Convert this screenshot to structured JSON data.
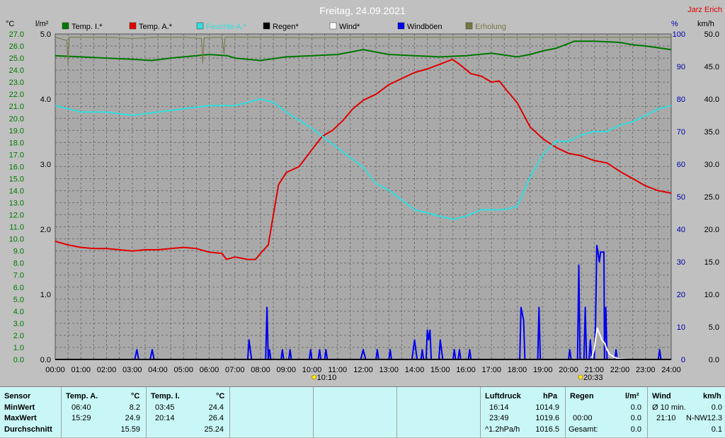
{
  "title": "Freitag, 24.09.2021",
  "station": "Jarz Erich",
  "units": {
    "left_outer": "°C",
    "left_inner": "l/m²",
    "right_inner": "%",
    "right_outer": "km/h"
  },
  "legend": [
    {
      "label": "Temp. I.*",
      "color": "#007700"
    },
    {
      "label": "Temp. A.*",
      "color": "#e00000"
    },
    {
      "label": "Feuchte A.*",
      "color": "#33dddd"
    },
    {
      "label": "Regen*",
      "color": "#000000"
    },
    {
      "label": "Wind*",
      "color": "#ffffff"
    },
    {
      "label": "Windböen",
      "color": "#0000ee"
    },
    {
      "label": "Erholung",
      "color": "#777744"
    }
  ],
  "markers": [
    {
      "time": "10:10",
      "hour": 10.17
    },
    {
      "time": "20:33",
      "hour": 20.55
    }
  ],
  "chart_data": {
    "type": "line",
    "title": "Freitag, 24.09.2021",
    "x_ticks": [
      "00:00",
      "01:00",
      "02:00",
      "03:00",
      "04:00",
      "05:00",
      "06:00",
      "07:00",
      "08:00",
      "09:00",
      "10:00",
      "11:00",
      "12:00",
      "13:00",
      "14:00",
      "15:00",
      "16:00",
      "17:00",
      "18:00",
      "19:00",
      "20:00",
      "21:00",
      "22:00",
      "23:00",
      "24:00"
    ],
    "xlim": [
      0,
      24
    ],
    "axes": {
      "temp_c": {
        "min": 0.0,
        "max": 27.0,
        "step": 1.0,
        "color": "#007700"
      },
      "rain_lm2": {
        "min": 0.0,
        "max": 5.0,
        "step": 1.0,
        "color": "#000000"
      },
      "humidity_pct": {
        "min": 0,
        "max": 100,
        "step": 10,
        "color": "#0000aa"
      },
      "wind_kmh": {
        "min": 0.0,
        "max": 50.0,
        "step": 5.0,
        "color": "#000000"
      }
    },
    "grid": true,
    "series": [
      {
        "name": "Temp. A.*",
        "axis": "temp_c",
        "color": "#e00000",
        "points": [
          [
            0,
            9.8
          ],
          [
            0.5,
            9.5
          ],
          [
            1,
            9.3
          ],
          [
            1.5,
            9.2
          ],
          [
            2,
            9.2
          ],
          [
            2.5,
            9.1
          ],
          [
            3,
            9.0
          ],
          [
            3.5,
            9.1
          ],
          [
            4,
            9.1
          ],
          [
            4.5,
            9.2
          ],
          [
            5,
            9.3
          ],
          [
            5.5,
            9.2
          ],
          [
            6,
            8.9
          ],
          [
            6.5,
            8.8
          ],
          [
            6.67,
            8.3
          ],
          [
            7,
            8.5
          ],
          [
            7.5,
            8.3
          ],
          [
            7.8,
            8.3
          ],
          [
            8,
            8.8
          ],
          [
            8.3,
            9.5
          ],
          [
            8.5,
            12
          ],
          [
            8.7,
            14.5
          ],
          [
            9,
            15.5
          ],
          [
            9.5,
            16.0
          ],
          [
            10,
            17.4
          ],
          [
            10.4,
            18.5
          ],
          [
            10.8,
            19.0
          ],
          [
            11.2,
            19.8
          ],
          [
            11.6,
            20.8
          ],
          [
            12,
            21.5
          ],
          [
            12.5,
            22.0
          ],
          [
            13,
            22.8
          ],
          [
            13.5,
            23.3
          ],
          [
            14,
            23.8
          ],
          [
            14.5,
            24.1
          ],
          [
            15,
            24.5
          ],
          [
            15.48,
            24.9
          ],
          [
            15.8,
            24.4
          ],
          [
            16.2,
            23.7
          ],
          [
            16.6,
            23.5
          ],
          [
            17,
            23.0
          ],
          [
            17.3,
            23.1
          ],
          [
            17.6,
            22.3
          ],
          [
            18,
            21.3
          ],
          [
            18.5,
            19.3
          ],
          [
            19,
            18.3
          ],
          [
            19.5,
            17.6
          ],
          [
            20,
            17.1
          ],
          [
            20.5,
            16.9
          ],
          [
            21,
            16.5
          ],
          [
            21.5,
            16.3
          ],
          [
            22,
            15.6
          ],
          [
            22.5,
            15.0
          ],
          [
            23,
            14.4
          ],
          [
            23.5,
            14.0
          ],
          [
            24,
            13.8
          ]
        ]
      },
      {
        "name": "Temp. I.*",
        "axis": "temp_c",
        "color": "#007700",
        "points": [
          [
            0,
            25.2
          ],
          [
            1,
            25.1
          ],
          [
            2,
            25.0
          ],
          [
            3,
            24.9
          ],
          [
            3.75,
            24.8
          ],
          [
            4.5,
            25.0
          ],
          [
            5,
            25.1
          ],
          [
            5.5,
            25.2
          ],
          [
            6,
            25.3
          ],
          [
            6.7,
            25.2
          ],
          [
            7,
            25.0
          ],
          [
            8,
            24.8
          ],
          [
            9,
            25.1
          ],
          [
            10,
            25.2
          ],
          [
            11,
            25.3
          ],
          [
            11.5,
            25.5
          ],
          [
            12,
            25.7
          ],
          [
            12.5,
            25.5
          ],
          [
            13,
            25.3
          ],
          [
            14,
            25.2
          ],
          [
            15,
            25.1
          ],
          [
            16,
            25.2
          ],
          [
            17,
            25.4
          ],
          [
            18,
            25.1
          ],
          [
            18.5,
            25.3
          ],
          [
            19,
            25.6
          ],
          [
            19.5,
            25.8
          ],
          [
            20.23,
            26.4
          ],
          [
            21,
            26.4
          ],
          [
            22,
            26.3
          ],
          [
            22.5,
            26.1
          ],
          [
            23,
            26.0
          ],
          [
            24,
            25.7
          ]
        ]
      },
      {
        "name": "Feuchte A.*",
        "axis": "humidity_pct",
        "color": "#33dddd",
        "points": [
          [
            0,
            78
          ],
          [
            0.5,
            77
          ],
          [
            1,
            76
          ],
          [
            2,
            76
          ],
          [
            3,
            75
          ],
          [
            4,
            76
          ],
          [
            5,
            77
          ],
          [
            6,
            78
          ],
          [
            7,
            78
          ],
          [
            7.5,
            79
          ],
          [
            8,
            80
          ],
          [
            8.5,
            79
          ],
          [
            9,
            76
          ],
          [
            10,
            71
          ],
          [
            10.5,
            68
          ],
          [
            11,
            65
          ],
          [
            11.5,
            62
          ],
          [
            12,
            59
          ],
          [
            12.5,
            54
          ],
          [
            13,
            52
          ],
          [
            13.5,
            49
          ],
          [
            14,
            46
          ],
          [
            14.5,
            45
          ],
          [
            15,
            44
          ],
          [
            15.5,
            43
          ],
          [
            16,
            44
          ],
          [
            16.3,
            45
          ],
          [
            16.6,
            46
          ],
          [
            17,
            46
          ],
          [
            17.5,
            46
          ],
          [
            18,
            47
          ],
          [
            18.5,
            56
          ],
          [
            19,
            63
          ],
          [
            19.5,
            67
          ],
          [
            20,
            67
          ],
          [
            20.5,
            69
          ],
          [
            21,
            70
          ],
          [
            21.5,
            70
          ],
          [
            22,
            72
          ],
          [
            22.5,
            73
          ],
          [
            23,
            75
          ],
          [
            23.5,
            77
          ],
          [
            24,
            78
          ]
        ]
      },
      {
        "name": "Erholung",
        "axis": "wind_kmh",
        "color": "#777744",
        "points": [
          [
            0,
            49.5
          ],
          [
            0.45,
            49
          ],
          [
            0.5,
            45.5
          ],
          [
            0.55,
            49.5
          ],
          [
            2,
            49.5
          ],
          [
            3,
            49.3
          ],
          [
            4,
            49.5
          ],
          [
            5,
            49.5
          ],
          [
            5.7,
            49.3
          ],
          [
            5.75,
            45.5
          ],
          [
            5.8,
            49.4
          ],
          [
            6.5,
            49.5
          ],
          [
            6.58,
            47
          ],
          [
            6.62,
            49.5
          ],
          [
            8,
            49.5
          ],
          [
            10,
            49.4
          ],
          [
            12,
            49.5
          ],
          [
            14,
            49.5
          ],
          [
            16,
            49.5
          ],
          [
            18,
            49.5
          ],
          [
            20,
            49.5
          ],
          [
            22,
            49.5
          ],
          [
            24,
            49.5
          ]
        ]
      },
      {
        "name": "Windböen",
        "axis": "wind_kmh",
        "color": "#0000ee",
        "points": [
          [
            0,
            0
          ],
          [
            3.1,
            0
          ],
          [
            3.18,
            1.5
          ],
          [
            3.25,
            0
          ],
          [
            3.7,
            0
          ],
          [
            3.78,
            1.5
          ],
          [
            3.85,
            0
          ],
          [
            7.5,
            0
          ],
          [
            7.55,
            3
          ],
          [
            7.6,
            1.5
          ],
          [
            7.65,
            0
          ],
          [
            8.2,
            0
          ],
          [
            8.25,
            8
          ],
          [
            8.3,
            0
          ],
          [
            8.35,
            1.5
          ],
          [
            8.4,
            0
          ],
          [
            8.8,
            0
          ],
          [
            8.85,
            1.5
          ],
          [
            8.9,
            0
          ],
          [
            9.1,
            0
          ],
          [
            9.15,
            1.5
          ],
          [
            9.2,
            0
          ],
          [
            9.9,
            0
          ],
          [
            9.95,
            1.5
          ],
          [
            10,
            0
          ],
          [
            10.25,
            0
          ],
          [
            10.3,
            1.5
          ],
          [
            10.35,
            0
          ],
          [
            10.5,
            0
          ],
          [
            10.55,
            1.5
          ],
          [
            10.6,
            0
          ],
          [
            11.9,
            0
          ],
          [
            12,
            1.5
          ],
          [
            12.1,
            0
          ],
          [
            12.5,
            0
          ],
          [
            12.55,
            1.5
          ],
          [
            12.6,
            0
          ],
          [
            13,
            0
          ],
          [
            13.05,
            1.5
          ],
          [
            13.1,
            0
          ],
          [
            13.9,
            0
          ],
          [
            14,
            3
          ],
          [
            14.1,
            0
          ],
          [
            14.25,
            0
          ],
          [
            14.3,
            1.5
          ],
          [
            14.35,
            0
          ],
          [
            14.45,
            0
          ],
          [
            14.5,
            4.5
          ],
          [
            14.55,
            3
          ],
          [
            14.6,
            4.5
          ],
          [
            14.65,
            0
          ],
          [
            14.95,
            0
          ],
          [
            15,
            3
          ],
          [
            15.1,
            0
          ],
          [
            15.5,
            0
          ],
          [
            15.55,
            1.5
          ],
          [
            15.6,
            0
          ],
          [
            15.7,
            0
          ],
          [
            15.75,
            1.5
          ],
          [
            15.8,
            0
          ],
          [
            16.1,
            0
          ],
          [
            16.15,
            1.5
          ],
          [
            16.2,
            0
          ],
          [
            18.1,
            0
          ],
          [
            18.15,
            8
          ],
          [
            18.25,
            6
          ],
          [
            18.3,
            0
          ],
          [
            18.8,
            0
          ],
          [
            18.85,
            8
          ],
          [
            18.9,
            0
          ],
          [
            20,
            0
          ],
          [
            20.05,
            1.5
          ],
          [
            20.1,
            0
          ],
          [
            20.35,
            0
          ],
          [
            20.4,
            14.5
          ],
          [
            20.45,
            0
          ],
          [
            20.6,
            0
          ],
          [
            20.65,
            8
          ],
          [
            20.7,
            0
          ],
          [
            20.8,
            0
          ],
          [
            20.85,
            3
          ],
          [
            20.9,
            0
          ],
          [
            21.0,
            0
          ],
          [
            21.05,
            5
          ],
          [
            21.1,
            17.5
          ],
          [
            21.15,
            16.5
          ],
          [
            21.2,
            15
          ],
          [
            21.25,
            16.5
          ],
          [
            21.3,
            16.5
          ],
          [
            21.38,
            16.5
          ],
          [
            21.4,
            0
          ],
          [
            21.45,
            8
          ],
          [
            21.5,
            0
          ],
          [
            21.8,
            0
          ],
          [
            21.85,
            1.5
          ],
          [
            21.9,
            0
          ],
          [
            23.5,
            0
          ],
          [
            23.55,
            1.5
          ],
          [
            23.6,
            0
          ],
          [
            24,
            0
          ]
        ]
      },
      {
        "name": "Wind*",
        "axis": "wind_kmh",
        "color": "#ffffff",
        "points": [
          [
            20.9,
            0.2
          ],
          [
            21.0,
            1.5
          ],
          [
            21.05,
            3.0
          ],
          [
            21.12,
            4.8
          ],
          [
            21.2,
            4.0
          ],
          [
            21.3,
            3.0
          ],
          [
            21.4,
            2.5
          ],
          [
            21.5,
            1.5
          ],
          [
            21.6,
            0.8
          ],
          [
            21.8,
            0.3
          ],
          [
            22.0,
            0.1
          ],
          [
            22.3,
            0
          ],
          [
            22.4,
            0
          ]
        ]
      },
      {
        "name": "Regen*",
        "axis": "rain_lm2",
        "color": "#000000",
        "points": [
          [
            0,
            0
          ],
          [
            24,
            0
          ]
        ]
      }
    ]
  },
  "stats": {
    "sensor_header": "Sensor",
    "rows": [
      "MinWert",
      "MaxWert",
      "Durchschnitt"
    ],
    "temp_a": {
      "header": "Temp. A.",
      "unit": "°C",
      "min_time": "06:40",
      "min": "8.2",
      "max_time": "15:29",
      "max": "24.9",
      "avg": "15.59"
    },
    "temp_i": {
      "header": "Temp. I.",
      "unit": "°C",
      "min_time": "03:45",
      "min": "24.4",
      "max_time": "20:14",
      "max": "26.4",
      "avg": "25.24"
    },
    "pressure": {
      "header": "Luftdruck",
      "unit": "hPa",
      "min_time": "16:14",
      "min": "1014.9",
      "max_time": "23:49",
      "max": "1019.6",
      "trend_label": "^1.2hPa/h",
      "trend_value": "1016.5"
    },
    "rain": {
      "header": "Regen",
      "unit": "l/m²",
      "row2_time": "00:00",
      "row2_value": "0.0",
      "total_label": "Gesamt:",
      "total": "0.0",
      "row1_value": "0.0"
    },
    "wind": {
      "header": "Wind",
      "unit": "km/h",
      "avg_label": "Ø 10 min.",
      "avg": "0.0",
      "max_time": "21:10",
      "max_dir": "N-NW",
      "max": "12.3",
      "row3": "0.1"
    }
  }
}
